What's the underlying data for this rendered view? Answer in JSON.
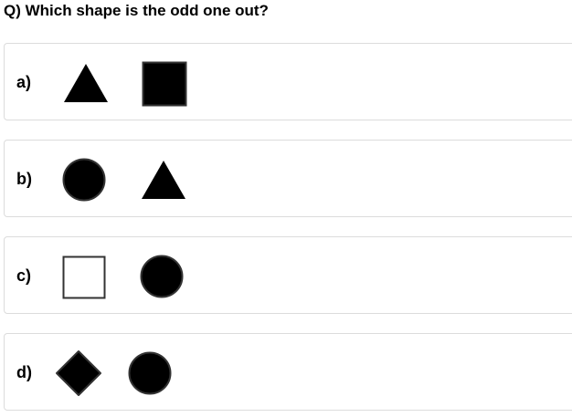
{
  "question": {
    "text": "Q) Which shape is the odd one out?"
  },
  "options": [
    {
      "label": "a)",
      "shapes": [
        "triangle-filled",
        "square-filled"
      ]
    },
    {
      "label": "b)",
      "shapes": [
        "circle-filled",
        "triangle-filled"
      ]
    },
    {
      "label": "c)",
      "shapes": [
        "square-outline",
        "circle-filled"
      ]
    },
    {
      "label": "d)",
      "shapes": [
        "diamond-filled",
        "circle-filled"
      ]
    }
  ],
  "colors": {
    "shape_fill": "#000000",
    "shape_stroke": "#333333",
    "outline_fill": "#ffffff",
    "card_border": "#dcdcdc"
  }
}
